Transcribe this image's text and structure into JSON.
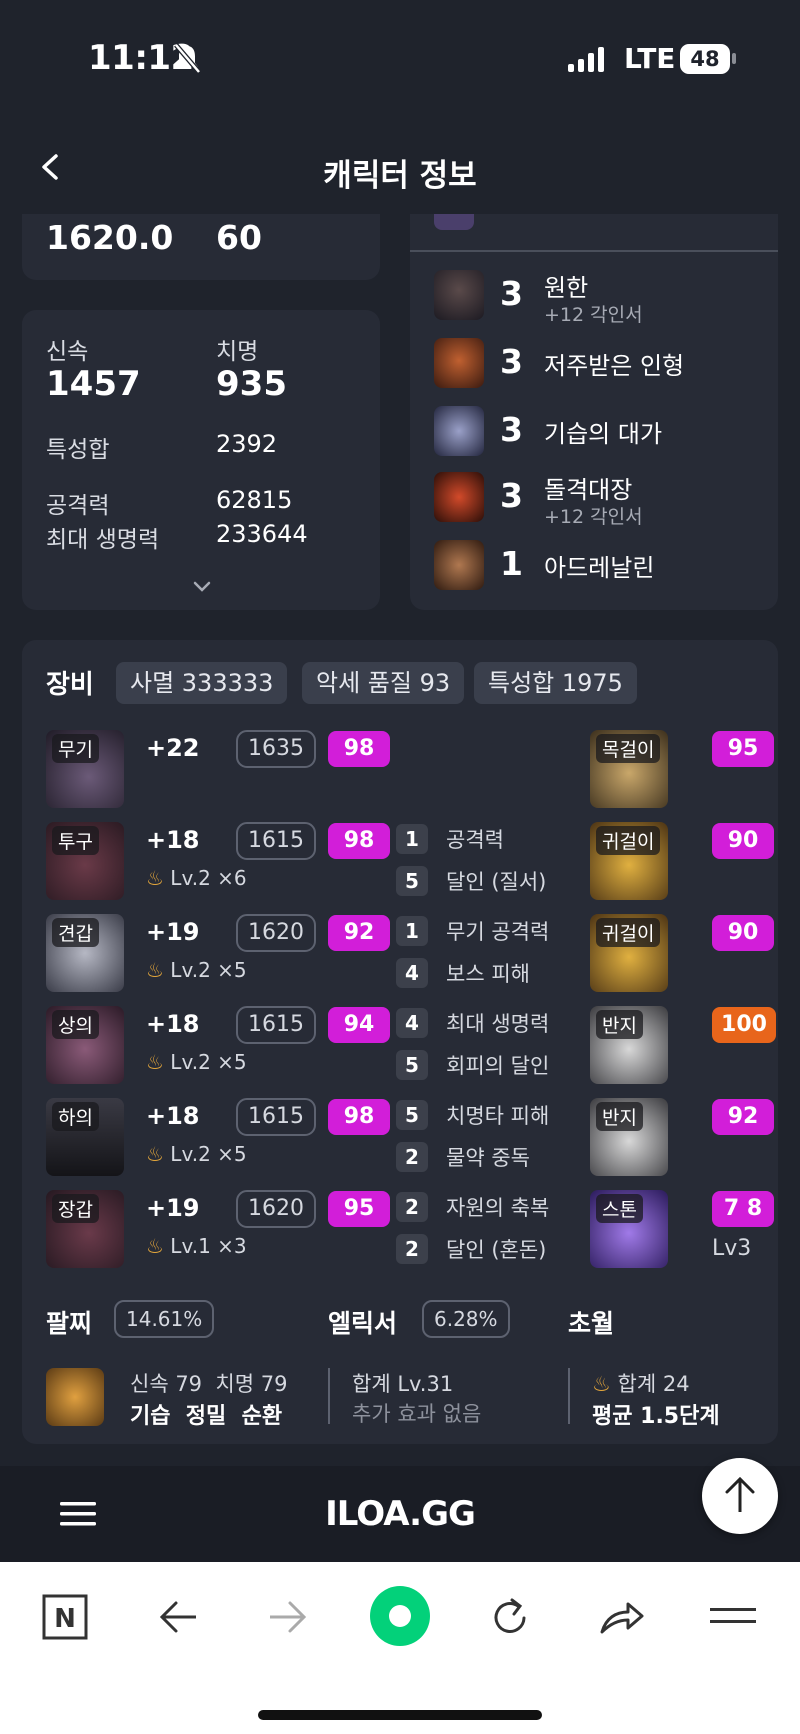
{
  "status": {
    "time": "11:12",
    "network": "LTE",
    "battery": "48"
  },
  "header": {
    "title": "캐릭터 정보"
  },
  "top_stats": {
    "left": "1620.0",
    "right": "60"
  },
  "stats": {
    "speed_label": "신속",
    "speed_value": "1457",
    "crit_label": "치명",
    "crit_value": "935",
    "trait_sum_label": "특성합",
    "trait_sum_value": "2392",
    "attack_label": "공격력",
    "attack_value": "62815",
    "hp_label": "최대 생명력",
    "hp_value": "233644"
  },
  "engravings": [
    {
      "level": "3",
      "name": "원한",
      "sub": "+12 각인서"
    },
    {
      "level": "3",
      "name": "저주받은 인형",
      "sub": ""
    },
    {
      "level": "3",
      "name": "기습의 대가",
      "sub": ""
    },
    {
      "level": "3",
      "name": "돌격대장",
      "sub": "+12 각인서"
    },
    {
      "level": "1",
      "name": "아드레날린",
      "sub": ""
    }
  ],
  "equipment": {
    "title": "장비",
    "chips": [
      "사멸 333333",
      "악세 품질 93",
      "특성합 1975"
    ],
    "gear": [
      {
        "slot": "무기",
        "plus": "+22",
        "ilvl": "1635",
        "quality": "98",
        "lv": "",
        "count": ""
      },
      {
        "slot": "투구",
        "plus": "+18",
        "ilvl": "1615",
        "quality": "98",
        "lv": "Lv.2",
        "count": "×6"
      },
      {
        "slot": "견갑",
        "plus": "+19",
        "ilvl": "1620",
        "quality": "92",
        "lv": "Lv.2",
        "count": "×5"
      },
      {
        "slot": "상의",
        "plus": "+18",
        "ilvl": "1615",
        "quality": "94",
        "lv": "Lv.2",
        "count": "×5"
      },
      {
        "slot": "하의",
        "plus": "+18",
        "ilvl": "1615",
        "quality": "98",
        "lv": "Lv.2",
        "count": "×5"
      },
      {
        "slot": "장갑",
        "plus": "+19",
        "ilvl": "1620",
        "quality": "95",
        "lv": "Lv.1",
        "count": "×3"
      }
    ],
    "effects": [
      {
        "n": "1",
        "t": "공격력"
      },
      {
        "n": "5",
        "t": "달인 (질서)"
      },
      {
        "n": "1",
        "t": "무기 공격력"
      },
      {
        "n": "4",
        "t": "보스 피해"
      },
      {
        "n": "4",
        "t": "최대 생명력"
      },
      {
        "n": "5",
        "t": "회피의 달인"
      },
      {
        "n": "5",
        "t": "치명타 피해"
      },
      {
        "n": "2",
        "t": "물약 중독"
      },
      {
        "n": "2",
        "t": "자원의 축복"
      },
      {
        "n": "2",
        "t": "달인 (혼돈)"
      }
    ],
    "accessories": [
      {
        "slot": "목걸이",
        "quality": "95",
        "color": "#d21ed9"
      },
      {
        "slot": "귀걸이",
        "quality": "90",
        "color": "#d21ed9"
      },
      {
        "slot": "귀걸이",
        "quality": "90",
        "color": "#d21ed9"
      },
      {
        "slot": "반지",
        "quality": "100",
        "color": "#e8651b"
      },
      {
        "slot": "반지",
        "quality": "92",
        "color": "#d21ed9"
      },
      {
        "slot": "스톤",
        "quality": "7 8",
        "color": "#d21ed9"
      }
    ],
    "stone_level": "Lv3"
  },
  "bracelet": {
    "title": "팔찌",
    "pct": "14.61%",
    "stats": "신속 79  치명 79",
    "effects": "기습  정밀  순환"
  },
  "elixir": {
    "title": "엘릭서",
    "pct": "6.28%",
    "sum": "합계 Lv.31",
    "extra": "추가 효과 없음"
  },
  "transcend": {
    "title": "초월",
    "sum": "합계 24",
    "avg": "평균 1.5단계"
  },
  "site": {
    "logo": "ILOA.GG"
  }
}
